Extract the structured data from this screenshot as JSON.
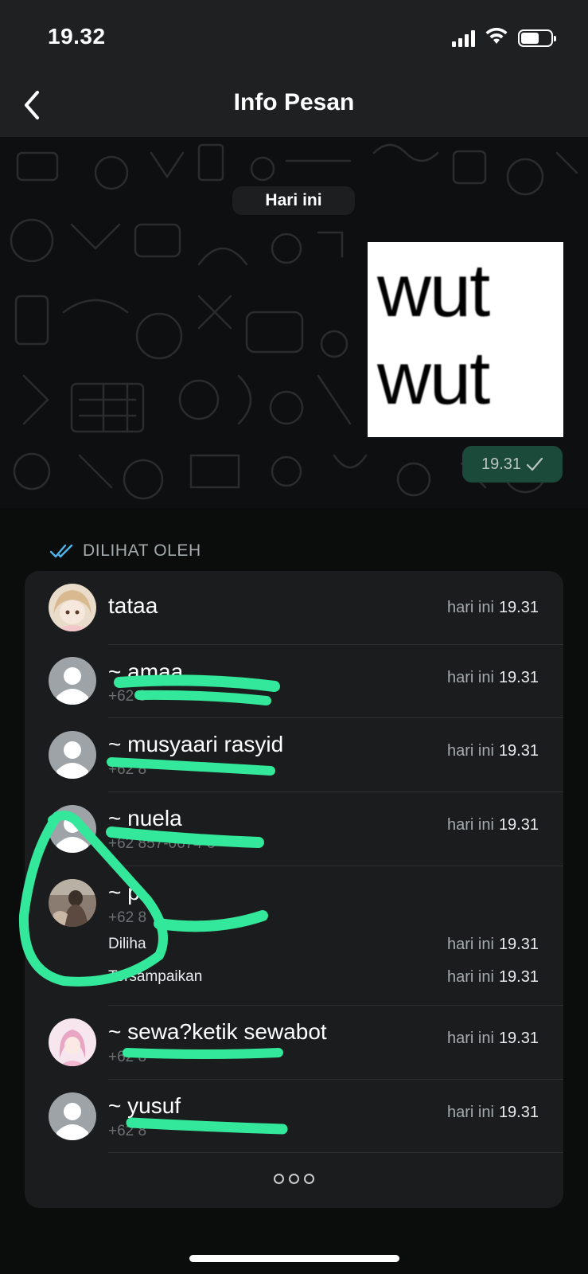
{
  "status_bar": {
    "time": "19.32"
  },
  "nav": {
    "title": "Info Pesan"
  },
  "chat": {
    "date_label": "Hari ini",
    "image_text_line1": "wut",
    "image_text_line2": "wut",
    "message_time": "19.31"
  },
  "seen_section": {
    "header": "DILIHAT OLEH",
    "accent_color": "#4fb6ec",
    "rows": [
      {
        "name": "tataa",
        "phone": "",
        "day": "hari ini",
        "time": "19.31"
      },
      {
        "name": "~ amaa",
        "phone": "+62 8",
        "day": "hari ini",
        "time": "19.31"
      },
      {
        "name": "~ musyaari rasyid",
        "phone": "+62 8",
        "day": "hari ini",
        "time": "19.31"
      },
      {
        "name": "~ nuela",
        "phone": "+62 857-0674-5",
        "day": "hari ini",
        "time": "19.31"
      },
      {
        "name": "~ p",
        "phone": "+62 8",
        "day": "hari ini",
        "time": "19.31",
        "seen_label": "Diliha",
        "delivered_label": "Tersampaikan",
        "delivered_day": "hari ini",
        "delivered_time": "19.31"
      },
      {
        "name": "~ sewa?ketik sewabot",
        "phone": "+62 8",
        "day": "hari ini",
        "time": "19.31"
      },
      {
        "name": "~ yusuf",
        "phone": "+62 8",
        "day": "hari ini",
        "time": "19.31"
      }
    ]
  },
  "colors": {
    "highlighter": "#33e89a",
    "bubble_green": "#1c4a3a"
  },
  "icons": [
    "back-chevron-icon",
    "signal-icon",
    "wifi-icon",
    "battery-icon",
    "double-check-icon",
    "check-icon",
    "default-avatar-icon",
    "more-icon"
  ]
}
